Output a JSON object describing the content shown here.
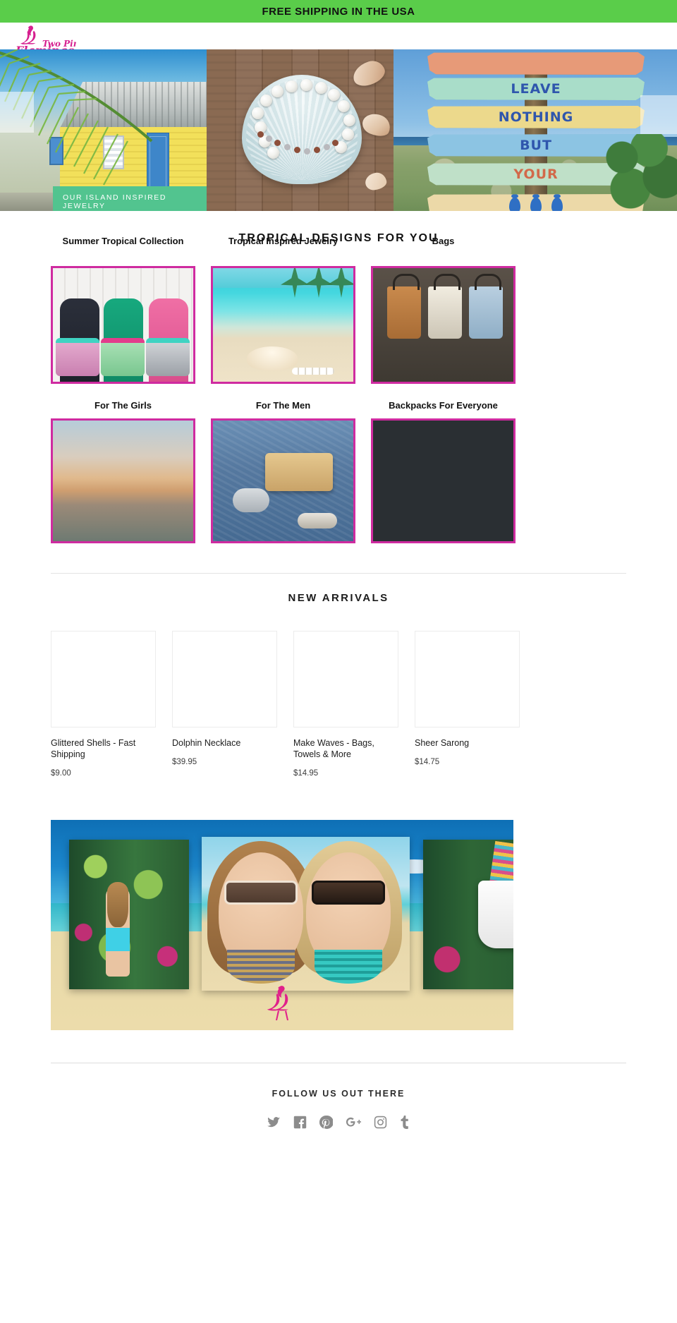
{
  "announcement": {
    "text": "FREE SHIPPING IN THE USA"
  },
  "brand": {
    "name": "Two Pink Flamingos",
    "line1": "Two Pink",
    "line2": "Flamingos",
    "accent": "#d61f8f"
  },
  "hero": {
    "cta_label": "OUR ISLAND INSPIRED JEWELRY",
    "cta_chevron": "›",
    "cta_bg": "#52c48f",
    "sign_lines": [
      "",
      "LEAVE",
      "NOTHING",
      "BUT",
      "YOUR",
      ""
    ]
  },
  "collections": {
    "heading": "TROPICAL DESIGNS FOR YOU",
    "border_color": "#cf2ba0",
    "row1": [
      {
        "name": "Summer Tropical Collection",
        "art": "bags"
      },
      {
        "name": "Tropical Inspired Jewelry",
        "art": "beach"
      },
      {
        "name": "Bags",
        "art": "totes"
      }
    ],
    "row2": [
      {
        "name": "For The Girls",
        "art": "sunset"
      },
      {
        "name": "For The Men",
        "art": "denim"
      },
      {
        "name": "Backpacks For Everyone",
        "art": "postcards"
      }
    ]
  },
  "new_arrivals": {
    "heading": "NEW ARRIVALS",
    "products": [
      {
        "name": "Glittered Shells - Fast Shipping",
        "price": "$9.00"
      },
      {
        "name": "Dolphin Necklace",
        "price": "$39.95"
      },
      {
        "name": "Make Waves - Bags, Towels & More",
        "price": "$14.95"
      },
      {
        "name": "Sheer Sarong",
        "price": "$14.75"
      }
    ]
  },
  "footer": {
    "follow_heading": "FOLLOW US OUT THERE",
    "social_icons": [
      {
        "name": "twitter-icon"
      },
      {
        "name": "facebook-icon"
      },
      {
        "name": "pinterest-icon"
      },
      {
        "name": "google-plus-icon"
      },
      {
        "name": "instagram-icon"
      },
      {
        "name": "tumblr-icon"
      }
    ]
  }
}
